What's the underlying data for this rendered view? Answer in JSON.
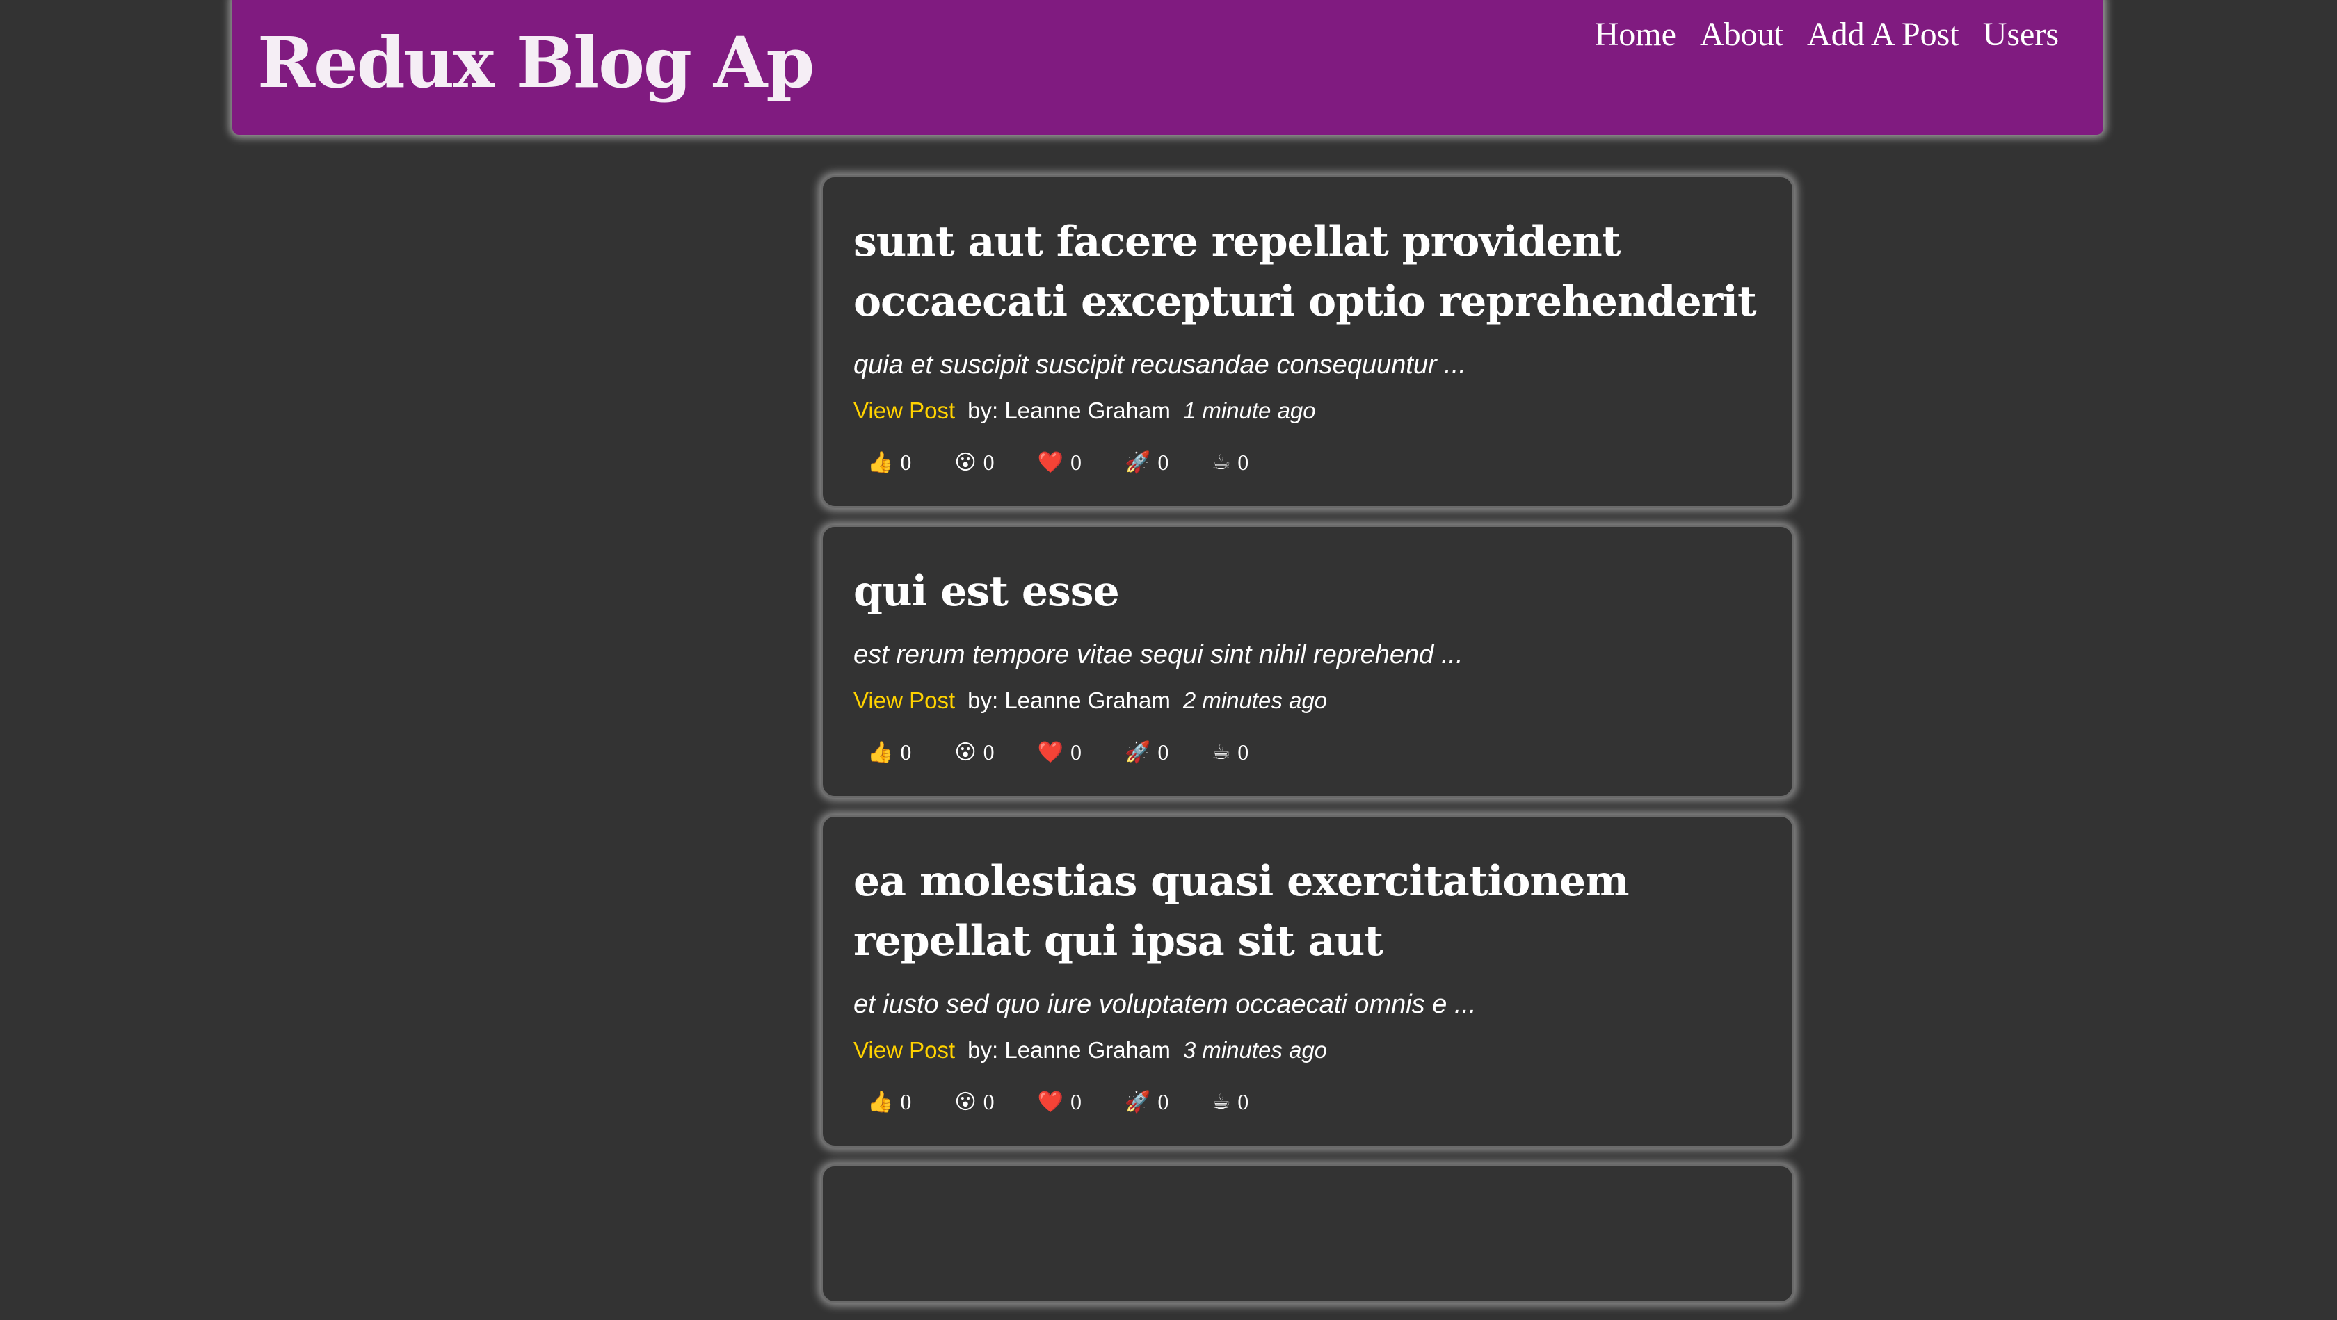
{
  "header": {
    "title": "Redux Blog Ap",
    "nav": [
      "Home",
      "About",
      "Add A Post",
      "Users"
    ]
  },
  "posts": [
    {
      "title": "sunt aut facere repellat provident occaecati excepturi optio reprehenderit",
      "excerpt": "quia et suscipit suscipit recusandae consequuntur ...",
      "link": "View Post",
      "author": "by: Leanne Graham",
      "time": "1 minute ago",
      "reactions": [
        {
          "icon": "👍",
          "name": "thumbs-up-icon",
          "count": "0"
        },
        {
          "icon": "😮",
          "name": "wow-icon",
          "count": "0"
        },
        {
          "icon": "❤️",
          "name": "heart-icon",
          "count": "0"
        },
        {
          "icon": "🚀",
          "name": "rocket-icon",
          "count": "0"
        },
        {
          "icon": "☕",
          "name": "coffee-icon",
          "count": "0"
        }
      ]
    },
    {
      "title": "qui est esse",
      "excerpt": "est rerum tempore vitae sequi sint nihil reprehend ...",
      "link": "View Post",
      "author": "by: Leanne Graham",
      "time": "2 minutes ago",
      "reactions": [
        {
          "icon": "👍",
          "name": "thumbs-up-icon",
          "count": "0"
        },
        {
          "icon": "😮",
          "name": "wow-icon",
          "count": "0"
        },
        {
          "icon": "❤️",
          "name": "heart-icon",
          "count": "0"
        },
        {
          "icon": "🚀",
          "name": "rocket-icon",
          "count": "0"
        },
        {
          "icon": "☕",
          "name": "coffee-icon",
          "count": "0"
        }
      ]
    },
    {
      "title": "ea molestias quasi exercitationem repellat qui ipsa sit aut",
      "excerpt": "et iusto sed quo iure voluptatem occaecati omnis e ...",
      "link": "View Post",
      "author": "by: Leanne Graham",
      "time": "3 minutes ago",
      "reactions": [
        {
          "icon": "👍",
          "name": "thumbs-up-icon",
          "count": "0"
        },
        {
          "icon": "😮",
          "name": "wow-icon",
          "count": "0"
        },
        {
          "icon": "❤️",
          "name": "heart-icon",
          "count": "0"
        },
        {
          "icon": "🚀",
          "name": "rocket-icon",
          "count": "0"
        },
        {
          "icon": "☕",
          "name": "coffee-icon",
          "count": "0"
        }
      ]
    },
    {
      "title": "",
      "excerpt": "",
      "link": "",
      "author": "",
      "time": "",
      "reactions": []
    }
  ],
  "colors": {
    "background": "#333333",
    "header": "#801b80",
    "link": "#ffd200"
  }
}
